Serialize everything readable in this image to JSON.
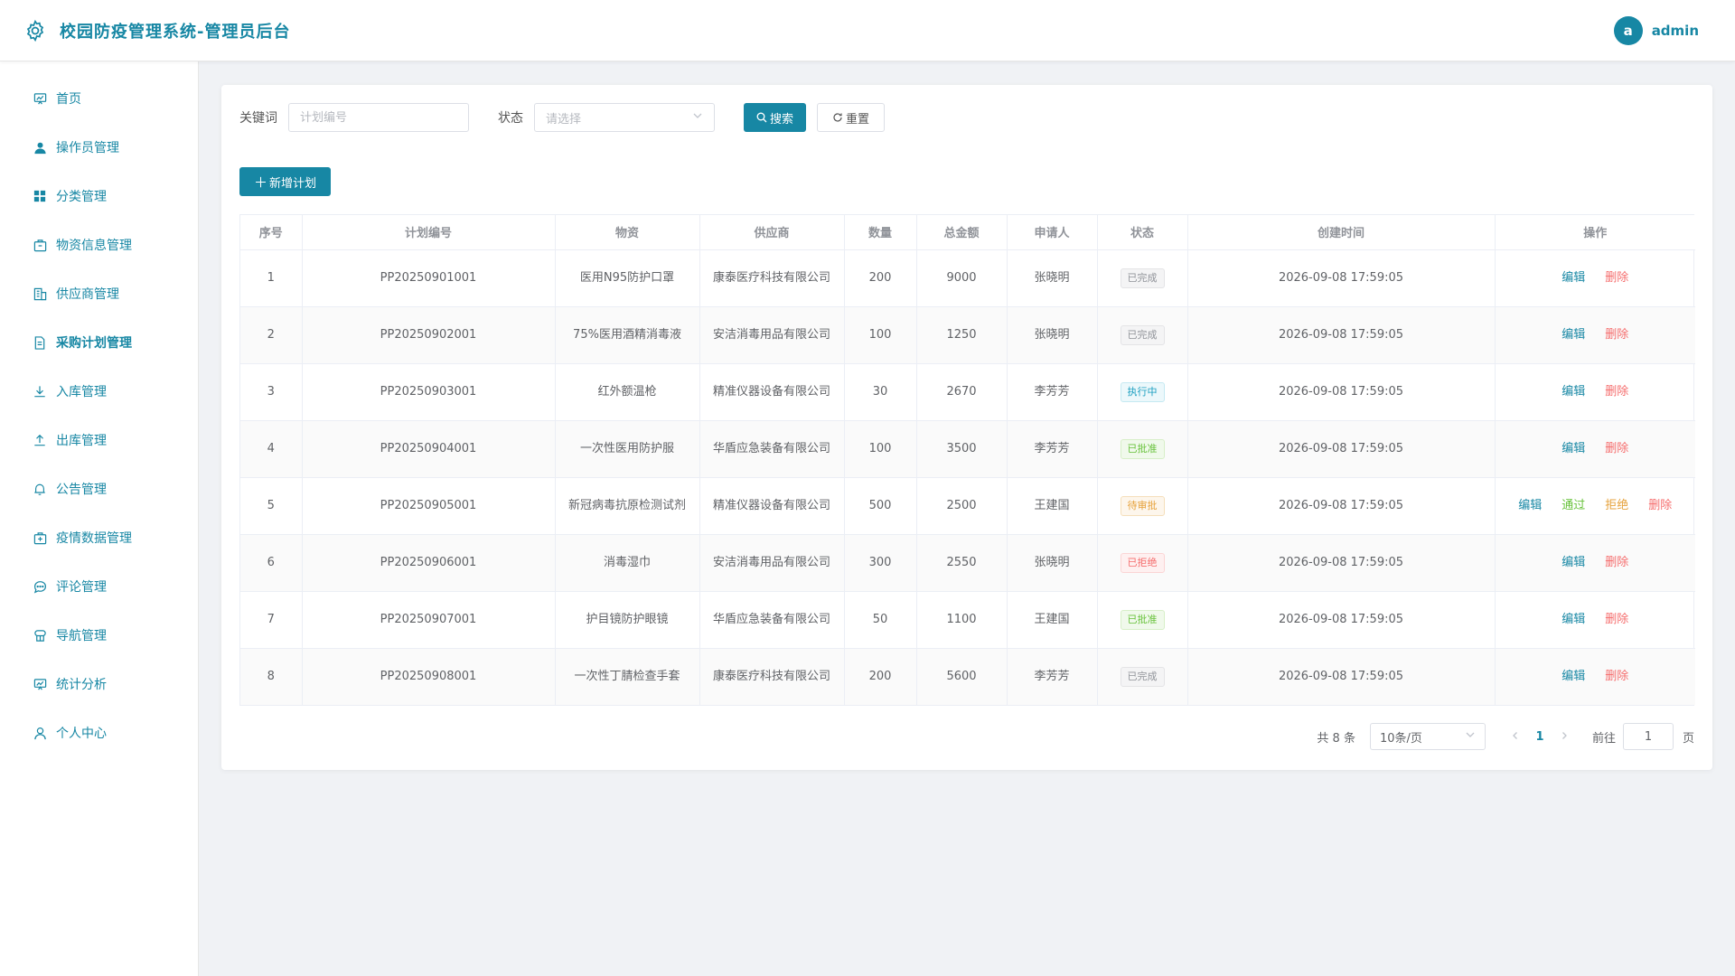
{
  "header": {
    "title": "校园防疫管理系统-管理员后台",
    "avatar_letter": "a",
    "username": "admin"
  },
  "sidebar": {
    "items": [
      {
        "label": "首页",
        "icon": "chart-board-icon"
      },
      {
        "label": "操作员管理",
        "icon": "user-icon"
      },
      {
        "label": "分类管理",
        "icon": "grid-icon"
      },
      {
        "label": "物资信息管理",
        "icon": "box-icon"
      },
      {
        "label": "供应商管理",
        "icon": "building-icon"
      },
      {
        "label": "采购计划管理",
        "icon": "document-icon"
      },
      {
        "label": "入库管理",
        "icon": "download-icon"
      },
      {
        "label": "出库管理",
        "icon": "upload-icon"
      },
      {
        "label": "公告管理",
        "icon": "bell-icon"
      },
      {
        "label": "疫情数据管理",
        "icon": "medical-box-icon"
      },
      {
        "label": "评论管理",
        "icon": "chat-icon"
      },
      {
        "label": "导航管理",
        "icon": "compass-icon"
      },
      {
        "label": "统计分析",
        "icon": "chart-board-icon"
      },
      {
        "label": "个人中心",
        "icon": "person-icon"
      }
    ],
    "active_index": 5
  },
  "search": {
    "keyword_label": "关键词",
    "keyword_placeholder": "计划编号",
    "status_label": "状态",
    "status_placeholder": "请选择",
    "search_button": "搜索",
    "reset_button": "重置"
  },
  "add_button": "新增计划",
  "table": {
    "columns": [
      "序号",
      "计划编号",
      "物资",
      "供应商",
      "数量",
      "总金额",
      "申请人",
      "状态",
      "创建时间",
      "操作"
    ],
    "rows": [
      {
        "idx": "1",
        "code": "PP20250901001",
        "item": "医用N95防护口罩",
        "supplier": "康泰医疗科技有限公司",
        "qty": "200",
        "amount": "9000",
        "applicant": "张晓明",
        "status": "已完成",
        "status_type": "done",
        "time": "2026-09-08 17:59:05",
        "actions": [
          "编辑",
          "删除"
        ]
      },
      {
        "idx": "2",
        "code": "PP20250902001",
        "item": "75%医用酒精消毒液",
        "supplier": "安洁消毒用品有限公司",
        "qty": "100",
        "amount": "1250",
        "applicant": "张晓明",
        "status": "已完成",
        "status_type": "done",
        "time": "2026-09-08 17:59:05",
        "actions": [
          "编辑",
          "删除"
        ]
      },
      {
        "idx": "3",
        "code": "PP20250903001",
        "item": "红外额温枪",
        "supplier": "精准仪器设备有限公司",
        "qty": "30",
        "amount": "2670",
        "applicant": "李芳芳",
        "status": "执行中",
        "status_type": "exec",
        "time": "2026-09-08 17:59:05",
        "actions": [
          "编辑",
          "删除"
        ]
      },
      {
        "idx": "4",
        "code": "PP20250904001",
        "item": "一次性医用防护服",
        "supplier": "华盾应急装备有限公司",
        "qty": "100",
        "amount": "3500",
        "applicant": "李芳芳",
        "status": "已批准",
        "status_type": "appr",
        "time": "2026-09-08 17:59:05",
        "actions": [
          "编辑",
          "删除"
        ]
      },
      {
        "idx": "5",
        "code": "PP20250905001",
        "item": "新冠病毒抗原检测试剂",
        "supplier": "精准仪器设备有限公司",
        "qty": "500",
        "amount": "2500",
        "applicant": "王建国",
        "status": "待审批",
        "status_type": "wait",
        "time": "2026-09-08 17:59:05",
        "actions": [
          "编辑",
          "通过",
          "拒绝",
          "删除"
        ]
      },
      {
        "idx": "6",
        "code": "PP20250906001",
        "item": "消毒湿巾",
        "supplier": "安洁消毒用品有限公司",
        "qty": "300",
        "amount": "2550",
        "applicant": "张晓明",
        "status": "已拒绝",
        "status_type": "rej",
        "time": "2026-09-08 17:59:05",
        "actions": [
          "编辑",
          "删除"
        ]
      },
      {
        "idx": "7",
        "code": "PP20250907001",
        "item": "护目镜防护眼镜",
        "supplier": "华盾应急装备有限公司",
        "qty": "50",
        "amount": "1100",
        "applicant": "王建国",
        "status": "已批准",
        "status_type": "appr",
        "time": "2026-09-08 17:59:05",
        "actions": [
          "编辑",
          "删除"
        ]
      },
      {
        "idx": "8",
        "code": "PP20250908001",
        "item": "一次性丁腈检查手套",
        "supplier": "康泰医疗科技有限公司",
        "qty": "200",
        "amount": "5600",
        "applicant": "李芳芳",
        "status": "已完成",
        "status_type": "done",
        "time": "2026-09-08 17:59:05",
        "actions": [
          "编辑",
          "删除"
        ]
      }
    ]
  },
  "pagination": {
    "total_text": "共 8 条",
    "page_size": "10条/页",
    "current_page": "1",
    "goto_label": "前往",
    "goto_value": "1",
    "page_suffix": "页"
  }
}
